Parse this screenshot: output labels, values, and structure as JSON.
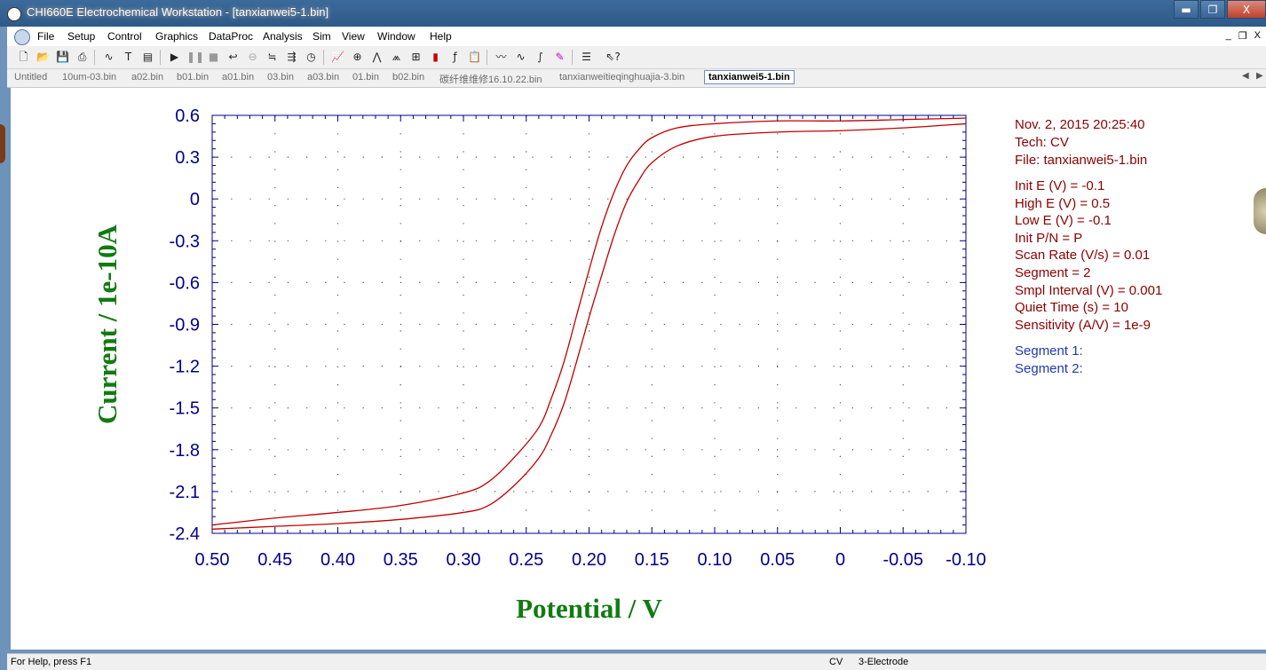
{
  "window": {
    "title": "CHI660E Electrochemical Workstation - [tanxianwei5-1.bin]",
    "minimize_glyph": "▬",
    "maximize_glyph": "❐",
    "close_glyph": "X"
  },
  "menubar": {
    "items": [
      "File",
      "Setup",
      "Control",
      "Graphics",
      "DataProc",
      "Analysis",
      "Sim",
      "View",
      "Window",
      "Help"
    ],
    "mdi_min": "_",
    "mdi_restore": "❐",
    "mdi_close": "X"
  },
  "toolbar": {
    "icons": [
      "new-file-icon",
      "open-file-icon",
      "save-icon",
      "print-icon",
      "technique-icon",
      "parameters-icon",
      "macro-icon",
      "run-icon",
      "pause-icon",
      "stop-icon",
      "reverse-scan-icon",
      "ir-comp-icon",
      "filter-icon",
      "cell-control-icon",
      "rotate-icon",
      "graph-options-icon",
      "zoom-icon",
      "peak-icon",
      "overlay-icon",
      "add-data-icon",
      "color-icon",
      "font-icon",
      "clipboard-icon",
      "smooth-icon",
      "derivative-icon",
      "integrate-icon",
      "tools-icon",
      "text-file-icon",
      "help-pointer-icon"
    ]
  },
  "tabs": {
    "items": [
      "Untitled",
      "10um-03.bin",
      "a02.bin",
      "b01.bin",
      "a01.bin",
      "03.bin",
      "a03.bin",
      "01.bin",
      "b02.bin",
      "碳纤维维修16.10.22.bin",
      "tanxianweitieqinghuajia-3.bin",
      "tanxianwei5-1.bin"
    ],
    "active_index": 11,
    "scroll_left": "◀",
    "scroll_right": "▶"
  },
  "info_panel": {
    "date_time": "Nov. 2, 2015   20:25:40",
    "tech": "Tech: CV",
    "file": "File: tanxianwei5-1.bin",
    "params": [
      "Init E (V) = -0.1",
      "High E (V) = 0.5",
      "Low E (V) = -0.1",
      "Init P/N = P",
      "Scan Rate (V/s) = 0.01",
      "Segment = 2",
      "Smpl Interval (V) = 0.001",
      "Quiet Time (s) = 10",
      "Sensitivity (A/V) = 1e-9"
    ],
    "segments": [
      "Segment 1:",
      "Segment 2:"
    ]
  },
  "status": {
    "help": "For Help, press F1",
    "technique": "CV",
    "electrode": "3-Electrode"
  },
  "colors": {
    "curve": "#c00000",
    "axis": "#00008b",
    "axis_label": "#127a12",
    "info_text": "#8b0000",
    "segment_text": "#1f39b3"
  },
  "chart_data": {
    "type": "line",
    "xlabel": "Potential / V",
    "ylabel": "Current / 1e-10A",
    "xlim": [
      0.5,
      -0.1
    ],
    "ylim": [
      -2.4,
      0.6
    ],
    "x_reversed": true,
    "x_ticks": [
      "0.50",
      "0.45",
      "0.40",
      "0.35",
      "0.30",
      "0.25",
      "0.20",
      "0.15",
      "0.10",
      "0.05",
      "0",
      "-0.05",
      "-0.10"
    ],
    "x_tick_values": [
      0.5,
      0.45,
      0.4,
      0.35,
      0.3,
      0.25,
      0.2,
      0.15,
      0.1,
      0.05,
      0,
      -0.05,
      -0.1
    ],
    "y_ticks": [
      "0.6",
      "0.3",
      "0",
      "-0.3",
      "-0.6",
      "-0.9",
      "-1.2",
      "-1.5",
      "-1.8",
      "-2.1",
      "-2.4"
    ],
    "y_tick_values": [
      0.6,
      0.3,
      0,
      -0.3,
      -0.6,
      -0.9,
      -1.2,
      -1.5,
      -1.8,
      -2.1,
      -2.4
    ],
    "grid": "dotted",
    "series": [
      {
        "x": [
          0.5,
          0.45,
          0.4,
          0.35,
          0.3,
          0.28,
          0.26,
          0.24,
          0.23,
          0.22,
          0.21,
          0.2,
          0.19,
          0.18,
          0.17,
          0.16,
          0.15,
          0.13,
          0.1,
          0.05,
          0,
          -0.05,
          -0.1
        ],
        "y": [
          -2.37,
          -2.35,
          -2.33,
          -2.3,
          -2.25,
          -2.2,
          -2.06,
          -1.86,
          -1.69,
          -1.47,
          -1.17,
          -0.85,
          -0.55,
          -0.26,
          -0.02,
          0.14,
          0.26,
          0.38,
          0.45,
          0.48,
          0.49,
          0.51,
          0.54
        ]
      },
      {
        "x": [
          0.5,
          0.45,
          0.4,
          0.35,
          0.3,
          0.28,
          0.26,
          0.24,
          0.23,
          0.22,
          0.21,
          0.2,
          0.19,
          0.18,
          0.17,
          0.16,
          0.15,
          0.13,
          0.1,
          0.05,
          0,
          -0.05,
          -0.1
        ],
        "y": [
          -2.34,
          -2.29,
          -2.25,
          -2.2,
          -2.11,
          -2.03,
          -1.86,
          -1.64,
          -1.43,
          -1.17,
          -0.84,
          -0.51,
          -0.2,
          0.05,
          0.24,
          0.36,
          0.44,
          0.51,
          0.54,
          0.56,
          0.56,
          0.57,
          0.58
        ]
      }
    ]
  }
}
